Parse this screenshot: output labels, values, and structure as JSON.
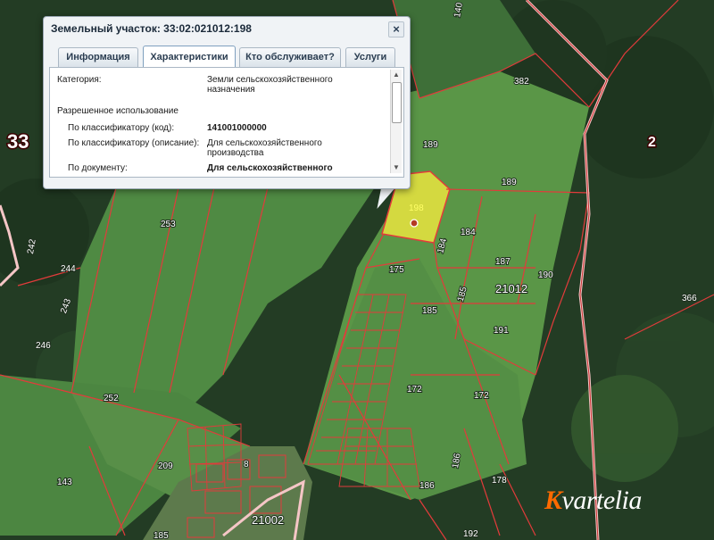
{
  "popup": {
    "title": "Земельный участок: 33:02:021012:198",
    "close_glyph": "×",
    "tabs": [
      {
        "label": "Информация",
        "active": false
      },
      {
        "label": "Характеристики",
        "active": true
      },
      {
        "label": "Кто обслуживает?",
        "active": false
      },
      {
        "label": "Услуги",
        "active": false
      }
    ],
    "rows": {
      "category_label": "Категория:",
      "category_value": "Земли сельскохозяйственного назначения",
      "permitted_use_label": "Разрешенное использование",
      "classifier_code_label": "По классификатору (код):",
      "classifier_code_value": "141001000000",
      "classifier_desc_label": "По классификатору (описание):",
      "classifier_desc_value": "Для сельскохозяйственного производства",
      "by_document_label": "По документу:",
      "by_document_value": "Для сельскохозяйственного"
    },
    "scroll": {
      "up_glyph": "▲",
      "down_glyph": "▼"
    }
  },
  "map": {
    "parcel_labels": [
      "198",
      "189",
      "189",
      "184",
      "184",
      "187",
      "190",
      "175",
      "185",
      "185",
      "191",
      "172",
      "172",
      "186",
      "178",
      "186",
      "192",
      "253",
      "252",
      "209",
      "143",
      "244",
      "243",
      "246",
      "242",
      "382",
      "366",
      "140",
      "8",
      "185"
    ],
    "selected_parcel": "198",
    "quarter_labels": [
      "21012",
      "21002"
    ],
    "district_labels": [
      "33",
      "2"
    ]
  },
  "watermark": {
    "first": "K",
    "rest": "vartelia"
  },
  "colors": {
    "boundary": "#e23b3b",
    "outer_boundary": "#f5c6c6",
    "selected_fill": "#d4d940",
    "field": "#4f8a43",
    "forest": "#213a22",
    "popup_bg": "#f0f3f6",
    "watermark_accent": "#ff6a00"
  }
}
